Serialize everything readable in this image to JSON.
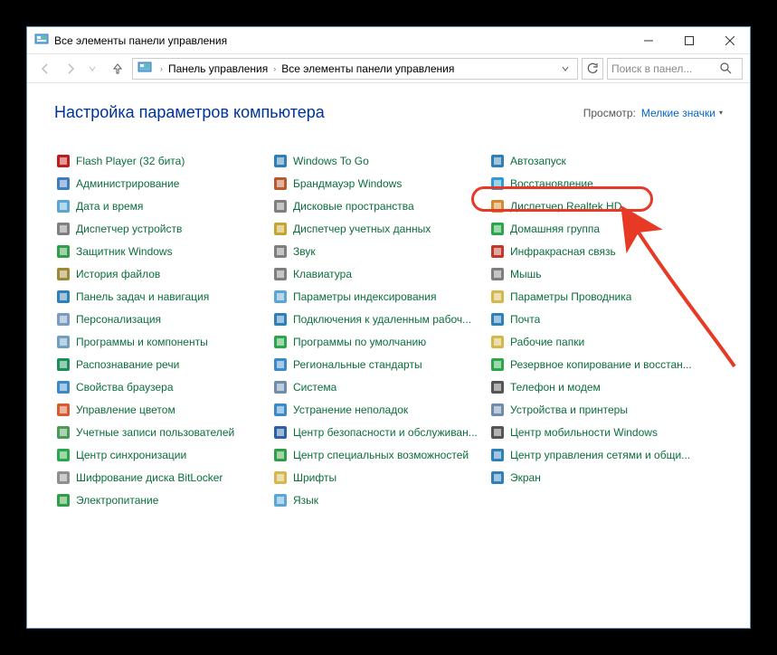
{
  "window": {
    "title": "Все элементы панели управления"
  },
  "nav": {
    "breadcrumbs": [
      "Панель управления",
      "Все элементы панели управления"
    ],
    "searchPlaceholder": "Поиск в панел..."
  },
  "page": {
    "heading": "Настройка параметров компьютера",
    "viewLabel": "Просмотр:",
    "viewValue": "Мелкие значки"
  },
  "items": {
    "col1": [
      {
        "label": "Flash Player (32 бита)",
        "c": "#c21b1b"
      },
      {
        "label": "Администрирование",
        "c": "#3f7dbf"
      },
      {
        "label": "Дата и время",
        "c": "#5aa7d6"
      },
      {
        "label": "Диспетчер устройств",
        "c": "#7f7f7f"
      },
      {
        "label": "Защитник Windows",
        "c": "#2f9e44"
      },
      {
        "label": "История файлов",
        "c": "#9e8836"
      },
      {
        "label": "Панель задач и навигация",
        "c": "#2f7fb8"
      },
      {
        "label": "Персонализация",
        "c": "#7a9cc0"
      },
      {
        "label": "Программы и компоненты",
        "c": "#6ea0c4"
      },
      {
        "label": "Распознавание речи",
        "c": "#1b8f5a"
      },
      {
        "label": "Свойства браузера",
        "c": "#3a8acb"
      },
      {
        "label": "Управление цветом",
        "c": "#d85a2e"
      },
      {
        "label": "Учетные записи пользователей",
        "c": "#4b9a55"
      },
      {
        "label": "Центр синхронизации",
        "c": "#2aa74a"
      },
      {
        "label": "Шифрование диска BitLocker",
        "c": "#8f8f8f"
      },
      {
        "label": "Электропитание",
        "c": "#2f9e44"
      }
    ],
    "col2": [
      {
        "label": "Windows To Go",
        "c": "#2f7fb8"
      },
      {
        "label": "Брандмауэр Windows",
        "c": "#b85a2e"
      },
      {
        "label": "Дисковые пространства",
        "c": "#7f7f7f"
      },
      {
        "label": "Диспетчер учетных данных",
        "c": "#c6a431"
      },
      {
        "label": "Звук",
        "c": "#7f7f7f"
      },
      {
        "label": "Клавиатура",
        "c": "#7f7f7f"
      },
      {
        "label": "Параметры индексирования",
        "c": "#5aa7d6"
      },
      {
        "label": "Подключения к удаленным рабоч...",
        "c": "#2f7fb8"
      },
      {
        "label": "Программы по умолчанию",
        "c": "#2aa74a"
      },
      {
        "label": "Региональные стандарты",
        "c": "#3a8acb"
      },
      {
        "label": "Система",
        "c": "#6e8cb0"
      },
      {
        "label": "Устранение неполадок",
        "c": "#3a8acb"
      },
      {
        "label": "Центр безопасности и обслуживан...",
        "c": "#2b62a7"
      },
      {
        "label": "Центр специальных возможностей",
        "c": "#2f9e44"
      },
      {
        "label": "Шрифты",
        "c": "#d6b84a"
      },
      {
        "label": "Язык",
        "c": "#5aa7d6"
      }
    ],
    "col3": [
      {
        "label": "Автозапуск",
        "c": "#2f7fb8"
      },
      {
        "label": "Восстановление",
        "c": "#2e9bd6",
        "highlight": true
      },
      {
        "label": "Диспетчер Realtek HD",
        "c": "#d68a2e"
      },
      {
        "label": "Домашняя группа",
        "c": "#2aa74a"
      },
      {
        "label": "Инфракрасная связь",
        "c": "#c0392b"
      },
      {
        "label": "Мышь",
        "c": "#7f7f7f"
      },
      {
        "label": "Параметры Проводника",
        "c": "#d6b84a"
      },
      {
        "label": "Почта",
        "c": "#2f7fb8"
      },
      {
        "label": "Рабочие папки",
        "c": "#d6b84a"
      },
      {
        "label": "Резервное копирование и восстан...",
        "c": "#2aa74a"
      },
      {
        "label": "Телефон и модем",
        "c": "#555555"
      },
      {
        "label": "Устройства и принтеры",
        "c": "#6e8cb0"
      },
      {
        "label": "Центр мобильности Windows",
        "c": "#555555"
      },
      {
        "label": "Центр управления сетями и общи...",
        "c": "#2f7fb8"
      },
      {
        "label": "Экран",
        "c": "#2f7fb8"
      }
    ]
  }
}
